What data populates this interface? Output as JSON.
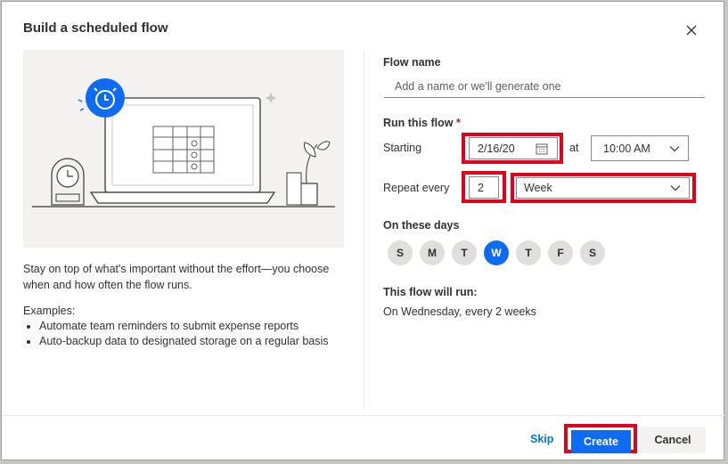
{
  "dialog": {
    "title": "Build a scheduled flow",
    "close_icon": "close-icon"
  },
  "left": {
    "description": "Stay on top of what's important without the effort—you choose when and how often the flow runs.",
    "examples_heading": "Examples:",
    "examples": [
      "Automate team reminders to submit expense reports",
      "Auto-backup data to designated storage on a regular basis"
    ]
  },
  "form": {
    "flow_name_label": "Flow name",
    "flow_name_placeholder": "Add a name or we'll generate one",
    "flow_name_value": "",
    "run_label": "Run this flow",
    "required_mark": "*",
    "starting_label": "Starting",
    "start_date": "2/16/20",
    "at_label": "at",
    "start_time": "10:00 AM",
    "repeat_label": "Repeat every",
    "repeat_interval": "2",
    "repeat_unit": "Week",
    "days_label": "On these days",
    "days": [
      {
        "label": "S",
        "selected": false
      },
      {
        "label": "M",
        "selected": false
      },
      {
        "label": "T",
        "selected": false
      },
      {
        "label": "W",
        "selected": true
      },
      {
        "label": "T",
        "selected": false
      },
      {
        "label": "F",
        "selected": false
      },
      {
        "label": "S",
        "selected": false
      }
    ],
    "summary_label": "This flow will run:",
    "summary_text": "On Wednesday, every 2 weeks"
  },
  "footer": {
    "skip_label": "Skip",
    "create_label": "Create",
    "cancel_label": "Cancel"
  },
  "colors": {
    "accent": "#0f6cf2",
    "highlight": "#e3001b",
    "day_unselected": "#e1dfdd"
  }
}
